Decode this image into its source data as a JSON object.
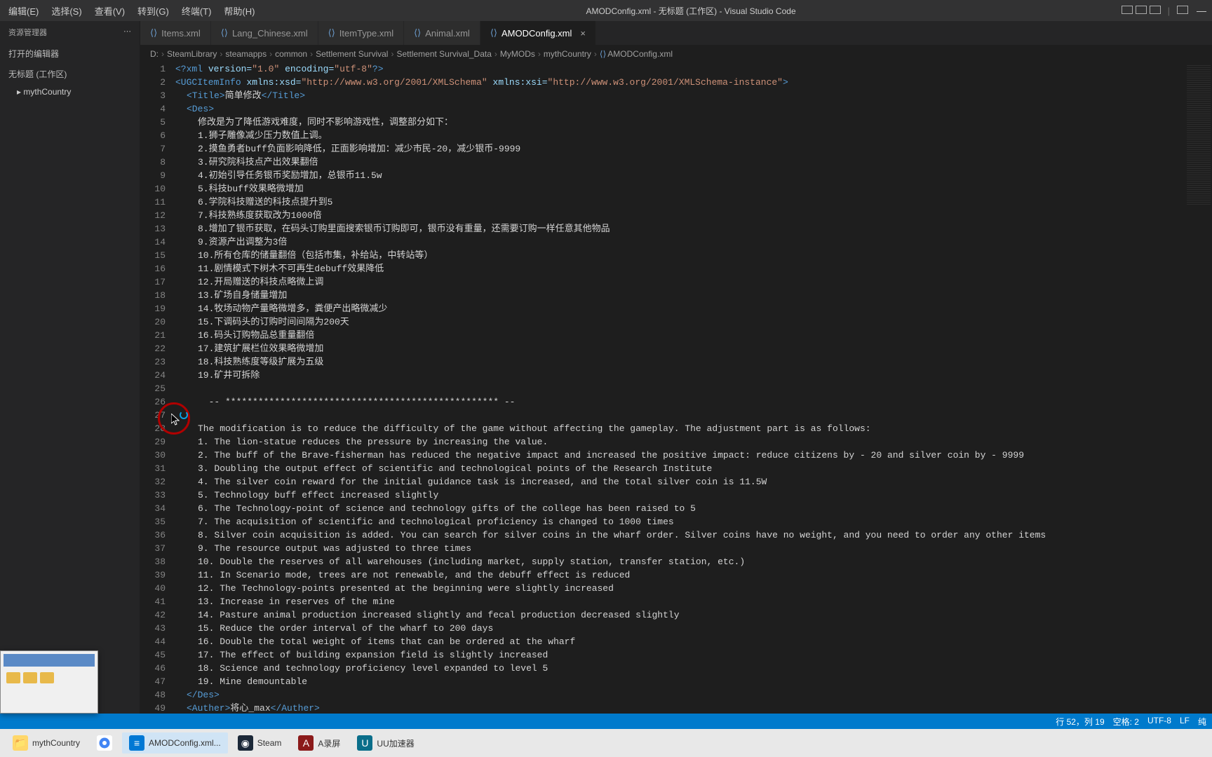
{
  "menu": {
    "edit": "编辑(E)",
    "select": "选择(S)",
    "view": "查看(V)",
    "go": "转到(G)",
    "terminal": "终端(T)",
    "help": "帮助(H)"
  },
  "title": "AMODConfig.xml - 无标题 (工作区) - Visual Studio Code",
  "sidebar": {
    "header": "资源管理器",
    "section1": "打开的编辑器",
    "section2": "无标题 (工作区)",
    "folder": "mythCountry"
  },
  "tabs": [
    {
      "label": "Items.xml"
    },
    {
      "label": "Lang_Chinese.xml"
    },
    {
      "label": "ItemType.xml"
    },
    {
      "label": "Animal.xml"
    },
    {
      "label": "AMODConfig.xml",
      "active": true
    }
  ],
  "breadcrumb": [
    "D:",
    "SteamLibrary",
    "steamapps",
    "common",
    "Settlement Survival",
    "Settlement Survival_Data",
    "MyMODs",
    "mythCountry",
    "AMODConfig.xml"
  ],
  "code": [
    {
      "n": 1,
      "cls": "",
      "html": "<span class='tag'>&lt;?xml</span> <span class='attr'>version=</span><span class='str'>\"1.0\"</span> <span class='attr'>encoding=</span><span class='str'>\"utf-8\"</span><span class='tag'>?&gt;</span>"
    },
    {
      "n": 2,
      "cls": "",
      "html": "<span class='tag'>&lt;UGCItemInfo</span> <span class='attr'>xmlns:xsd=</span><span class='str'>\"http://www.w3.org/2001/XMLSchema\"</span> <span class='attr'>xmlns:xsi=</span><span class='str'>\"http://www.w3.org/2001/XMLSchema-instance\"</span><span class='tag'>&gt;</span>"
    },
    {
      "n": 3,
      "cls": "pad1",
      "html": "<span class='tag'>&lt;Title&gt;</span>简单修改<span class='tag'>&lt;/Title&gt;</span>"
    },
    {
      "n": 4,
      "cls": "pad1",
      "html": "<span class='tag'>&lt;Des&gt;</span>"
    },
    {
      "n": 5,
      "cls": "pad2",
      "html": "修改是为了降低游戏难度，同时不影响游戏性，调整部分如下："
    },
    {
      "n": 6,
      "cls": "pad2",
      "html": "1.狮子雕像减少压力数值上调。"
    },
    {
      "n": 7,
      "cls": "pad2",
      "html": "2.摸鱼勇者buff负面影响降低，正面影响增加：减少市民-20，减少银币-9999"
    },
    {
      "n": 8,
      "cls": "pad2",
      "html": "3.研究院科技点产出效果翻倍"
    },
    {
      "n": 9,
      "cls": "pad2",
      "html": "4.初始引导任务银币奖励增加，总银币11.5w"
    },
    {
      "n": 10,
      "cls": "pad2",
      "html": "5.科技buff效果略微增加"
    },
    {
      "n": 11,
      "cls": "pad2",
      "html": "6.学院科技赠送的科技点提升到5"
    },
    {
      "n": 12,
      "cls": "pad2",
      "html": "7.科技熟练度获取改为1000倍"
    },
    {
      "n": 13,
      "cls": "pad2",
      "html": "8.增加了银币获取，在码头订购里面搜索银币订购即可，银币没有重量，还需要订购一样任意其他物品"
    },
    {
      "n": 14,
      "cls": "pad2",
      "html": "9.资源产出调整为3倍"
    },
    {
      "n": 15,
      "cls": "pad2",
      "html": "10.所有仓库的储量翻倍（包括市集，补给站，中转站等）"
    },
    {
      "n": 16,
      "cls": "pad2",
      "html": "11.剧情模式下树木不可再生debuff效果降低"
    },
    {
      "n": 17,
      "cls": "pad2",
      "html": "12.开局赠送的科技点略微上调"
    },
    {
      "n": 18,
      "cls": "pad2",
      "html": "13.矿场自身储量增加"
    },
    {
      "n": 19,
      "cls": "pad2",
      "html": "14.牧场动物产量略微增多，粪便产出略微减少"
    },
    {
      "n": 20,
      "cls": "pad2",
      "html": "15.下调码头的订购时间间隔为200天"
    },
    {
      "n": 21,
      "cls": "pad2",
      "html": "16.码头订购物品总重量翻倍"
    },
    {
      "n": 22,
      "cls": "pad2",
      "html": "17.建筑扩展栏位效果略微增加"
    },
    {
      "n": 23,
      "cls": "pad2",
      "html": "18.科技熟练度等级扩展为五级"
    },
    {
      "n": 24,
      "cls": "pad2",
      "html": "19.矿井可拆除"
    },
    {
      "n": 25,
      "cls": "pad2",
      "html": ""
    },
    {
      "n": 26,
      "cls": "pad2",
      "html": "  -- ************************************************** --"
    },
    {
      "n": 27,
      "cls": "pad2",
      "html": ""
    },
    {
      "n": 28,
      "cls": "pad2",
      "html": "The modification is to reduce the difficulty of the game without affecting the gameplay. The adjustment part is as follows:"
    },
    {
      "n": 29,
      "cls": "pad2",
      "html": "1. The lion-statue reduces the pressure by increasing the value."
    },
    {
      "n": 30,
      "cls": "pad2",
      "html": "2. The buff of the Brave-fisherman has reduced the negative impact and increased the positive impact: reduce citizens by - 20 and silver coin by - 9999"
    },
    {
      "n": 31,
      "cls": "pad2",
      "html": "3. Doubling the output effect of scientific and technological points of the Research Institute"
    },
    {
      "n": 32,
      "cls": "pad2",
      "html": "4. The silver coin reward for the initial guidance task is increased, and the total silver coin is 11.5W"
    },
    {
      "n": 33,
      "cls": "pad2",
      "html": "5. Technology buff effect increased slightly"
    },
    {
      "n": 34,
      "cls": "pad2",
      "html": "6. The Technology-point of science and technology gifts of the college has been raised to 5"
    },
    {
      "n": 35,
      "cls": "pad2",
      "html": "7. The acquisition of scientific and technological proficiency is changed to 1000 times"
    },
    {
      "n": 36,
      "cls": "pad2",
      "html": "8. Silver coin acquisition is added. You can search for silver coins in the wharf order. Silver coins have no weight, and you need to order any other items"
    },
    {
      "n": 37,
      "cls": "pad2",
      "html": "9. The resource output was adjusted to three times"
    },
    {
      "n": 38,
      "cls": "pad2",
      "html": "10. Double the reserves of all warehouses (including market, supply station, transfer station, etc.)"
    },
    {
      "n": 39,
      "cls": "pad2",
      "html": "11. In Scenario mode, trees are not renewable, and the debuff effect is reduced"
    },
    {
      "n": 40,
      "cls": "pad2",
      "html": "12. The Technology-points presented at the beginning were slightly increased"
    },
    {
      "n": 41,
      "cls": "pad2",
      "html": "13. Increase in reserves of the mine"
    },
    {
      "n": 42,
      "cls": "pad2",
      "html": "14. Pasture animal production increased slightly and fecal production decreased slightly"
    },
    {
      "n": 43,
      "cls": "pad2",
      "html": "15. Reduce the order interval of the wharf to 200 days"
    },
    {
      "n": 44,
      "cls": "pad2",
      "html": "16. Double the total weight of items that can be ordered at the wharf"
    },
    {
      "n": 45,
      "cls": "pad2",
      "html": "17. The effect of building expansion field is slightly increased"
    },
    {
      "n": 46,
      "cls": "pad2",
      "html": "18. Science and technology proficiency level expanded to level 5"
    },
    {
      "n": 47,
      "cls": "pad2",
      "html": "19. Mine demountable"
    },
    {
      "n": 48,
      "cls": "pad1",
      "html": "<span class='tag'>&lt;/Des&gt;</span>"
    },
    {
      "n": 49,
      "cls": "pad1",
      "html": "<span class='tag'>&lt;Auther&gt;</span>将心_max<span class='tag'>&lt;/Auther&gt;</span>"
    }
  ],
  "status": {
    "line_col": "行 52，列 19",
    "spaces": "空格: 2",
    "encoding": "UTF-8",
    "eol": "LF",
    "lang": "纯"
  },
  "taskbar": {
    "folder": "mythCountry",
    "vscode": "AMODConfig.xml...",
    "steam": "Steam",
    "record": "A录屏",
    "uu": "UU加速器"
  }
}
